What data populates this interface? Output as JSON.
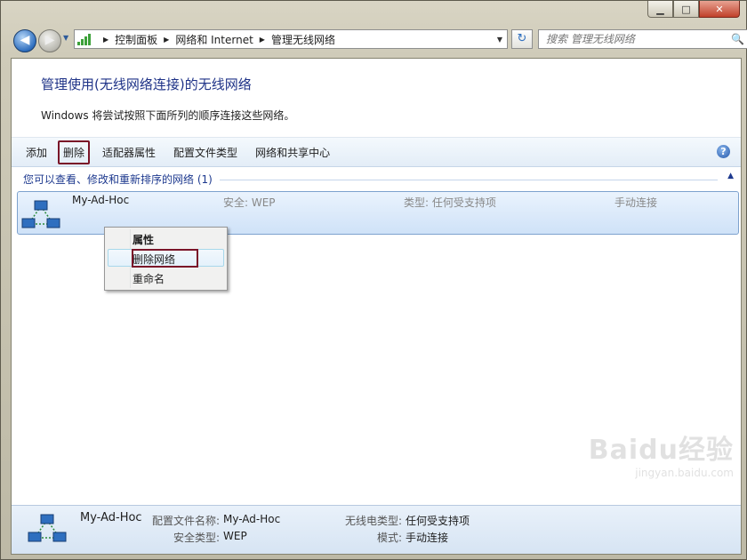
{
  "window": {
    "minimize": "▁",
    "maximize": "□",
    "close": "✕"
  },
  "navigation": {
    "back": "◀",
    "forward": "▶",
    "history": "▼"
  },
  "address_bar": {
    "crumbs": [
      "控制面板",
      "网络和 Internet",
      "管理无线网络"
    ],
    "separator": "▶",
    "dropdown": "▼",
    "refresh": "↻"
  },
  "search": {
    "placeholder": "搜索 管理无线网络",
    "icon": "🔍"
  },
  "page": {
    "title": "管理使用(无线网络连接)的无线网络",
    "description": "Windows 将尝试按照下面所列的顺序连接这些网络。"
  },
  "toolbar": {
    "items": [
      "添加",
      "删除",
      "适配器属性",
      "配置文件类型",
      "网络和共享中心"
    ],
    "help": "?"
  },
  "group": {
    "header": "您可以查看、修改和重新排序的网络 (1)",
    "collapse": "▲"
  },
  "network": {
    "name": "My-Ad-Hoc",
    "security": "安全: WEP",
    "type": "类型: 任何受支持项",
    "mode": "手动连接"
  },
  "context_menu": {
    "items": [
      "属性",
      "删除网络",
      "重命名"
    ]
  },
  "details": {
    "name": "My-Ad-Hoc",
    "profile_label": "配置文件名称:",
    "profile_value": "My-Ad-Hoc",
    "security_label": "安全类型:",
    "security_value": "WEP",
    "radio_label": "无线电类型:",
    "radio_value": "任何受支持项",
    "mode_label": "模式:",
    "mode_value": "手动连接"
  },
  "watermark": {
    "text": "Baidu经验",
    "url": "jingyan.baidu.com"
  },
  "colors": {
    "accent": "#1e3287",
    "highlight_box": "#7a1428",
    "selection_row": "#cfe2f8"
  }
}
